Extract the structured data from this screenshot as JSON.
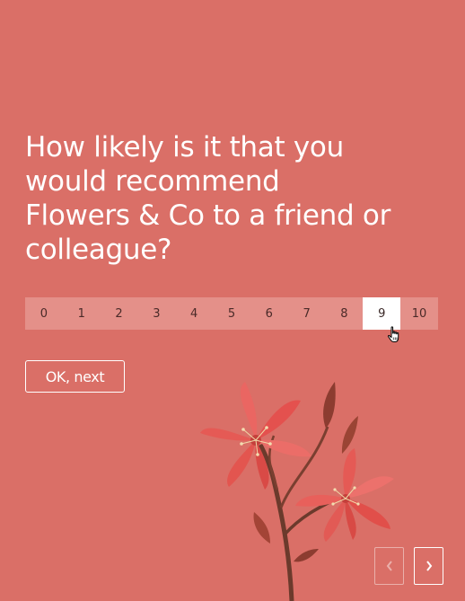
{
  "question": {
    "line1": "How likely is it that you",
    "line2": "would recommend",
    "line3": "Flowers & Co to a friend or",
    "line4": "colleague?"
  },
  "scale": {
    "options": [
      "0",
      "1",
      "2",
      "3",
      "4",
      "5",
      "6",
      "7",
      "8",
      "9",
      "10"
    ],
    "selected": "9"
  },
  "ok_button_label": "OK, next",
  "navigation": {
    "prev_icon": "chevron-left-icon",
    "next_icon": "chevron-right-icon"
  },
  "colors": {
    "background": "#da6f67",
    "scale_background": "#e49089",
    "selected": "#ffffff",
    "text": "#ffffff"
  }
}
